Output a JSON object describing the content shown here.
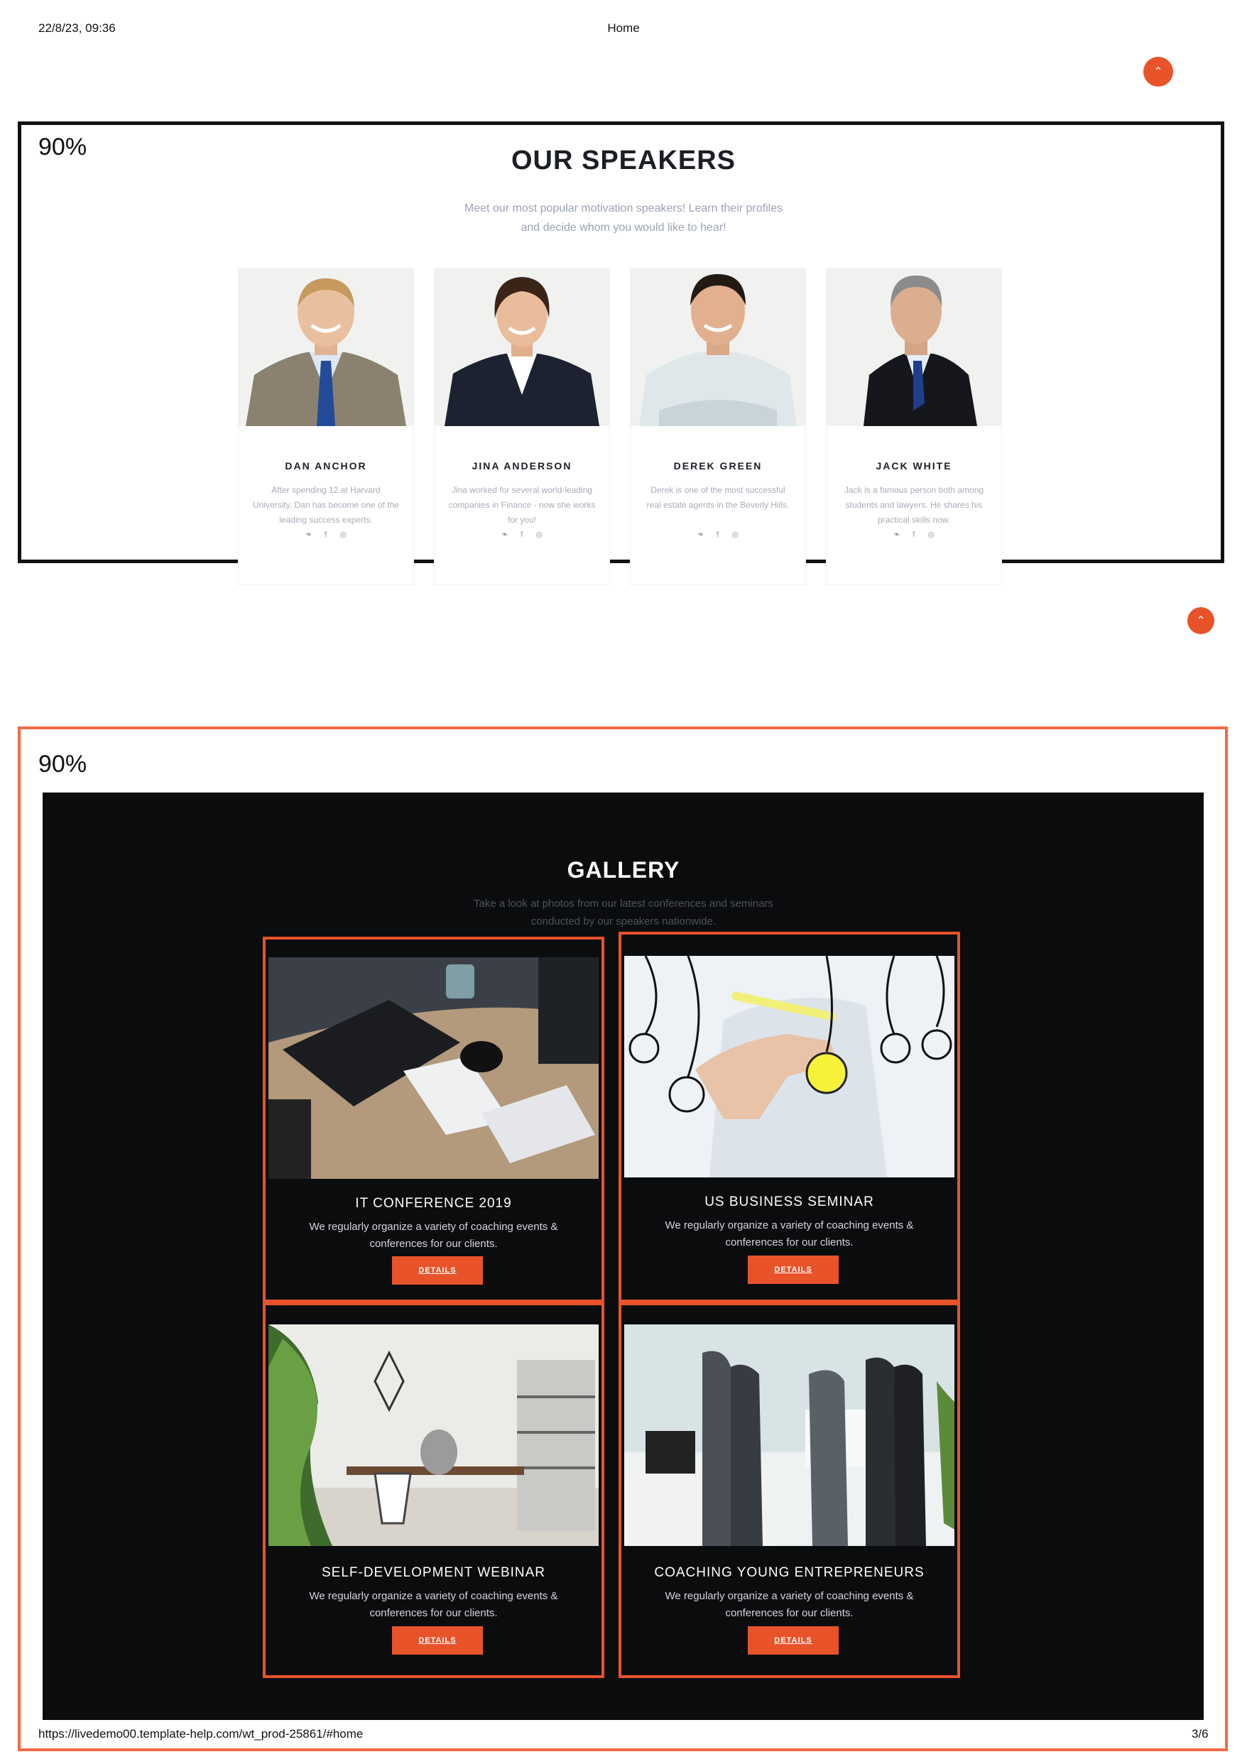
{
  "print": {
    "datetime": "22/8/23, 09:36",
    "title": "Home",
    "url": "https://livedemo00.template-help.com/wt_prod-25861/#home",
    "page": "3/6"
  },
  "colors": {
    "accent": "#e8532a",
    "frame_dark": "#111111",
    "frame_accent": "#ef6a46",
    "gallery_bg": "#0b0c0e"
  },
  "speakers_section": {
    "zoom": "90%",
    "title": "OUR SPEAKERS",
    "subtitle_line1": "Meet our most popular motivation speakers! Learn their profiles",
    "subtitle_line2": "and decide whom you would like to hear!",
    "speakers": [
      {
        "name": "DAN ANCHOR",
        "bio": "After spending 12 at Harvard University, Dan has become one of the leading success experts."
      },
      {
        "name": "JINA ANDERSON",
        "bio": "Jina worked for several world-leading companies in Finance - now she works for you!"
      },
      {
        "name": "DEREK GREEN",
        "bio": "Derek is one of the most successful real estate agents in the Beverly Hills."
      },
      {
        "name": "JACK WHITE",
        "bio": "Jack is a famous person both among students and lawyers. He shares his practical skills now."
      }
    ],
    "social_icons": [
      "twitter-icon",
      "facebook-icon",
      "instagram-icon"
    ],
    "social_glyphs": {
      "twitter": "❧",
      "facebook": "f",
      "instagram": "◎"
    }
  },
  "gallery_section": {
    "zoom": "90%",
    "title": "GALLERY",
    "subtitle_line1": "Take a look at photos from our latest conferences and seminars",
    "subtitle_line2": "conducted by our speakers nationwide.",
    "items": [
      {
        "heading": "IT CONFERENCE 2019",
        "text": "We regularly organize a variety of coaching events & conferences for our clients.",
        "button": "DETAILS"
      },
      {
        "heading": "US BUSINESS SEMINAR",
        "text": "We regularly organize a variety of coaching events & conferences for our clients.",
        "button": "DETAILS"
      },
      {
        "heading": "SELF-DEVELOPMENT WEBINAR",
        "text": "We regularly organize a variety of coaching events & conferences for our clients.",
        "button": "DETAILS"
      },
      {
        "heading": "COACHING YOUNG ENTREPRENEURS",
        "text": "We regularly organize a variety of coaching events & conferences for our clients.",
        "button": "DETAILS"
      }
    ]
  },
  "scroll_up_icon": "⌃"
}
